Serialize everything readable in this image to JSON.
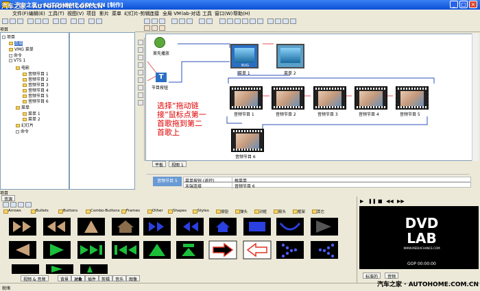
{
  "window": {
    "title": "汽车之家 · AUTOHOME.COM.CN [制作]"
  },
  "menu": [
    "文件(F)",
    "编辑(E)",
    "工具(T)",
    "视图(V)",
    "项目",
    "影片",
    "菜单",
    "幻灯片-剪辑",
    "连接",
    "全局 VM",
    "lab-对话",
    "工具",
    "窗口(W)",
    "帮助(H)"
  ],
  "left_panel": {
    "header": "项目",
    "tree": [
      {
        "label": "项目",
        "indent": 0
      },
      {
        "label": "连接",
        "indent": 1,
        "selected": true
      },
      {
        "label": "VMG 菜单",
        "indent": 1
      },
      {
        "label": "命令",
        "indent": 1
      },
      {
        "label": "VTS 1",
        "indent": 1
      },
      {
        "label": "电影",
        "indent": 2
      },
      {
        "label": "音频节目 1",
        "indent": 3
      },
      {
        "label": "音频节目 2",
        "indent": 3
      },
      {
        "label": "音频节目 3",
        "indent": 3
      },
      {
        "label": "音频节目 4",
        "indent": 3
      },
      {
        "label": "音频节目 5",
        "indent": 3
      },
      {
        "label": "音频节目 6",
        "indent": 3
      },
      {
        "label": "菜单",
        "indent": 2
      },
      {
        "label": "菜单 1",
        "indent": 3
      },
      {
        "label": "菜单 2",
        "indent": 3
      },
      {
        "label": "幻灯片",
        "indent": 2
      },
      {
        "label": "命令",
        "indent": 2
      }
    ],
    "bottom_tab": "项目"
  },
  "canvas": {
    "first_play_label": "首先播放",
    "title_button_label": "节目按钮",
    "menu1_label": "菜单 1",
    "menu2_label": "菜单 2",
    "menu1_text": "BUG",
    "films": [
      "音频节目 1",
      "音频节目 2",
      "音频节目 3",
      "音频节目 4",
      "音频节目 5",
      "音频节目 6"
    ],
    "annotation": "选择“拖动链接”鼠标点第一首歌拖到第二首歌上"
  },
  "canvas_tabs": [
    "平板",
    "视图 1"
  ],
  "properties": {
    "selected": "音频节目 5",
    "rows": [
      {
        "name": "菜单按钮 (遥控)",
        "value": "根菜单"
      },
      {
        "name": "末端连接",
        "value": "音频节目 6"
      }
    ]
  },
  "assets": {
    "top_tabs": [
      "资源"
    ],
    "categories": [
      "Arrows",
      "Bullets",
      "Buttons",
      "Combo-Buttons",
      "Frames",
      "Other",
      "Shapes",
      "Styles",
      "按钮",
      "弹头",
      "对框",
      "箭头",
      "框架",
      "其它"
    ],
    "bottom_tabs": [
      "视频 & 音频",
      "背景",
      "对象",
      "插件",
      "剪辑",
      "音乐",
      "图像"
    ]
  },
  "preview": {
    "tabs": [
      "标准的",
      "音频"
    ],
    "gop": "GOP 00:00:00",
    "logo_line1": "DVD",
    "logo_line2": "LAB",
    "logo_url": "WWW.MEDIACHANCE.COM"
  },
  "status": {
    "text": "就绪"
  },
  "watermark": "汽车之家 · AUTOHOME.COM.CN",
  "colors": {
    "titlebar": "#0a4fd8",
    "accent": "#316ac5",
    "annotation": "#e00000"
  }
}
